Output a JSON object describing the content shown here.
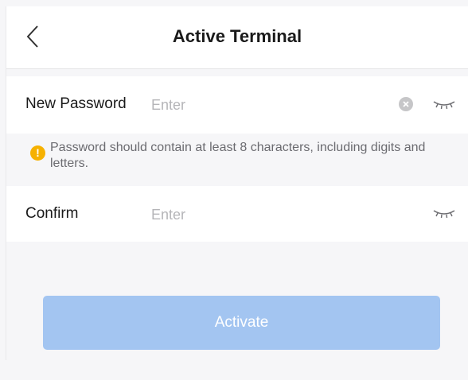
{
  "header": {
    "title": "Active Terminal",
    "back_icon": "chevron-left-icon"
  },
  "form": {
    "new_password": {
      "label": "New Password",
      "placeholder": "Enter",
      "value": "",
      "clear_icon": "clear-circle-icon",
      "visibility_icon": "eye-closed-icon"
    },
    "hint": {
      "icon": "info-icon",
      "text": "Password should contain at least 8 characters, including digits and letters."
    },
    "confirm": {
      "label": "Confirm",
      "placeholder": "Enter",
      "value": "",
      "visibility_icon": "eye-closed-icon"
    }
  },
  "actions": {
    "activate_label": "Activate"
  },
  "colors": {
    "background": "#f6f6f8",
    "button_disabled": "#a3c5f1",
    "hint_icon": "#f6b100"
  }
}
